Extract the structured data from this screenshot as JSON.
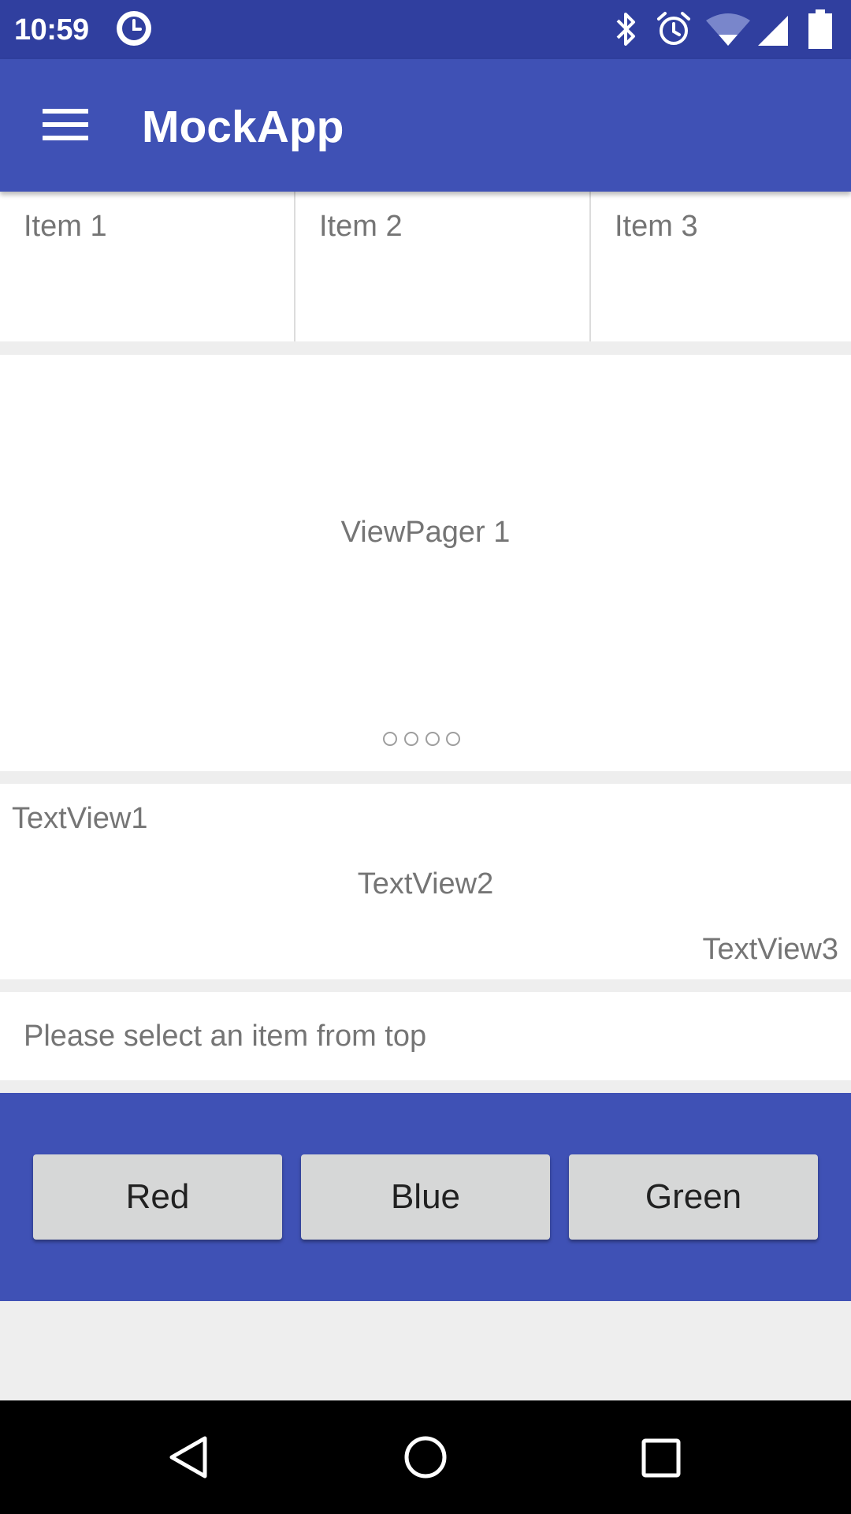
{
  "status_bar": {
    "time": "10:59",
    "icons": [
      "clock-app-icon",
      "bluetooth-icon",
      "alarm-icon",
      "wifi-icon",
      "signal-icon",
      "battery-icon"
    ],
    "color": "#303f9f"
  },
  "toolbar": {
    "title": "MockApp",
    "menu_icon": "hamburger-menu-icon",
    "color": "#3f51b5"
  },
  "items": [
    {
      "label": "Item 1"
    },
    {
      "label": "Item 2"
    },
    {
      "label": "Item 3"
    }
  ],
  "viewpager": {
    "label": "ViewPager 1",
    "page_count": 4,
    "current_page": 1
  },
  "textviews": {
    "tv1": "TextView1",
    "tv2": "TextView2",
    "tv3": "TextView3"
  },
  "selection": {
    "prompt": "Please select an item from top"
  },
  "buttons": {
    "red": "Red",
    "blue": "Blue",
    "green": "Green"
  },
  "nav_bar": {
    "icons": [
      "back-icon",
      "home-icon",
      "recents-icon"
    ]
  }
}
